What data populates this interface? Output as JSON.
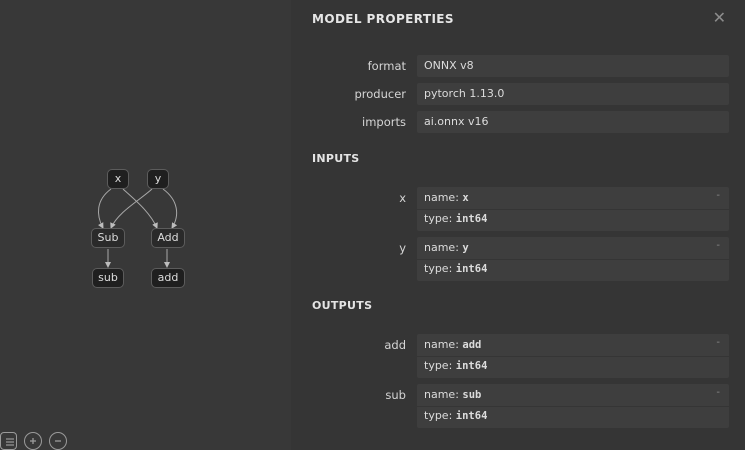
{
  "graph": {
    "nodes": [
      {
        "id": "x",
        "label": "x",
        "kind": "input"
      },
      {
        "id": "y",
        "label": "y",
        "kind": "input"
      },
      {
        "id": "Sub",
        "label": "Sub",
        "kind": "op"
      },
      {
        "id": "Add",
        "label": "Add",
        "kind": "op"
      },
      {
        "id": "sub",
        "label": "sub",
        "kind": "output"
      },
      {
        "id": "add",
        "label": "add",
        "kind": "output"
      }
    ],
    "toolbar": [
      "list-icon",
      "zoom-in-icon",
      "zoom-out-icon"
    ]
  },
  "sidebar": {
    "title": "MODEL PROPERTIES",
    "close_glyph": "✕",
    "properties": [
      {
        "label": "format",
        "value": "ONNX v8"
      },
      {
        "label": "producer",
        "value": "pytorch 1.13.0"
      },
      {
        "label": "imports",
        "value": "ai.onnx v16"
      }
    ],
    "inputs_header": "INPUTS",
    "inputs": [
      {
        "label": "x",
        "name_prefix": "name: ",
        "name": "x",
        "type_prefix": "type: ",
        "type": "int64"
      },
      {
        "label": "y",
        "name_prefix": "name: ",
        "name": "y",
        "type_prefix": "type: ",
        "type": "int64"
      }
    ],
    "outputs_header": "OUTPUTS",
    "outputs": [
      {
        "label": "add",
        "name_prefix": "name: ",
        "name": "add",
        "type_prefix": "type: ",
        "type": "int64"
      },
      {
        "label": "sub",
        "name_prefix": "name: ",
        "name": "sub",
        "type_prefix": "type: ",
        "type": "int64"
      }
    ],
    "expand_glyph": "-"
  }
}
